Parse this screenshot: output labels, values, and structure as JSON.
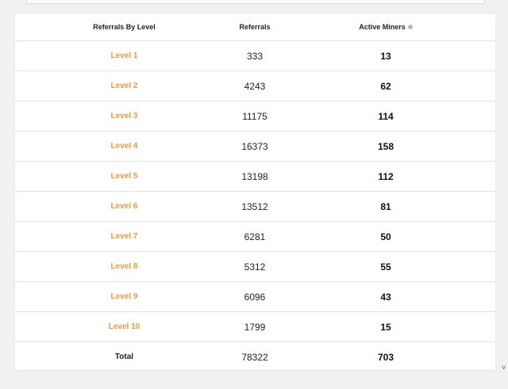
{
  "table": {
    "headers": {
      "level": "Referrals By Level",
      "referrals": "Referrals",
      "active_miners": "Active Miners"
    },
    "rows": [
      {
        "level": "Level 1",
        "referrals": "333",
        "active_miners": "13"
      },
      {
        "level": "Level 2",
        "referrals": "4243",
        "active_miners": "62"
      },
      {
        "level": "Level 3",
        "referrals": "11175",
        "active_miners": "114"
      },
      {
        "level": "Level 4",
        "referrals": "16373",
        "active_miners": "158"
      },
      {
        "level": "Level 5",
        "referrals": "13198",
        "active_miners": "112"
      },
      {
        "level": "Level 6",
        "referrals": "13512",
        "active_miners": "81"
      },
      {
        "level": "Level 7",
        "referrals": "6281",
        "active_miners": "50"
      },
      {
        "level": "Level 8",
        "referrals": "5312",
        "active_miners": "55"
      },
      {
        "level": "Level 9",
        "referrals": "6096",
        "active_miners": "43"
      },
      {
        "level": "Level 10",
        "referrals": "1799",
        "active_miners": "15"
      }
    ],
    "total": {
      "label": "Total",
      "referrals": "78322",
      "active_miners": "703"
    }
  },
  "icons": {
    "active_miners_info": "info-icon"
  },
  "colors": {
    "level_text": "#f0963c",
    "background": "#f1f1f1",
    "panel": "#ffffff"
  }
}
